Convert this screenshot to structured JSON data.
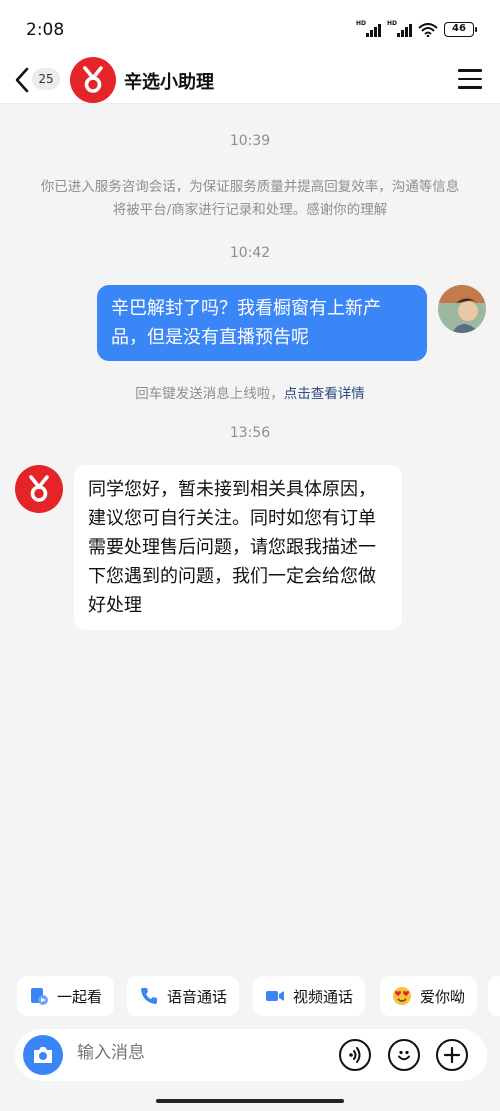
{
  "status_bar": {
    "time": "2:08",
    "battery": "46"
  },
  "header": {
    "unread_count": "25",
    "title": "辛选小助理"
  },
  "chat": {
    "time_1": "10:39",
    "notice": "你已进入服务咨询会话，为保证服务质量并提高回复效率，沟通等信息将被平台/商家进行记录和处理。感谢你的理解",
    "time_2": "10:42",
    "outgoing_message": "辛巴解封了吗？我看橱窗有上新产品，但是没有直播预告呢",
    "hint_text": "回车键发送消息上线啦，",
    "hint_link": "点击查看详情",
    "time_3": "13:56",
    "incoming_message": "同学您好，暂未接到相关具体原因，建议您可自行关注。同时如您有订单需要处理售后问题，请您跟我描述一下您遇到的问题，我们一定会给您做好处理"
  },
  "quick_actions": [
    {
      "label": "一起看",
      "icon": "watch-together-icon"
    },
    {
      "label": "语音通话",
      "icon": "phone-icon"
    },
    {
      "label": "视频通话",
      "icon": "video-camera-icon"
    },
    {
      "label": "爱你呦",
      "icon": "heart-eyes-emoji-icon"
    }
  ],
  "input": {
    "placeholder": "输入消息"
  },
  "colors": {
    "brand_red": "#e5242a",
    "accent_blue": "#3a86f7"
  }
}
